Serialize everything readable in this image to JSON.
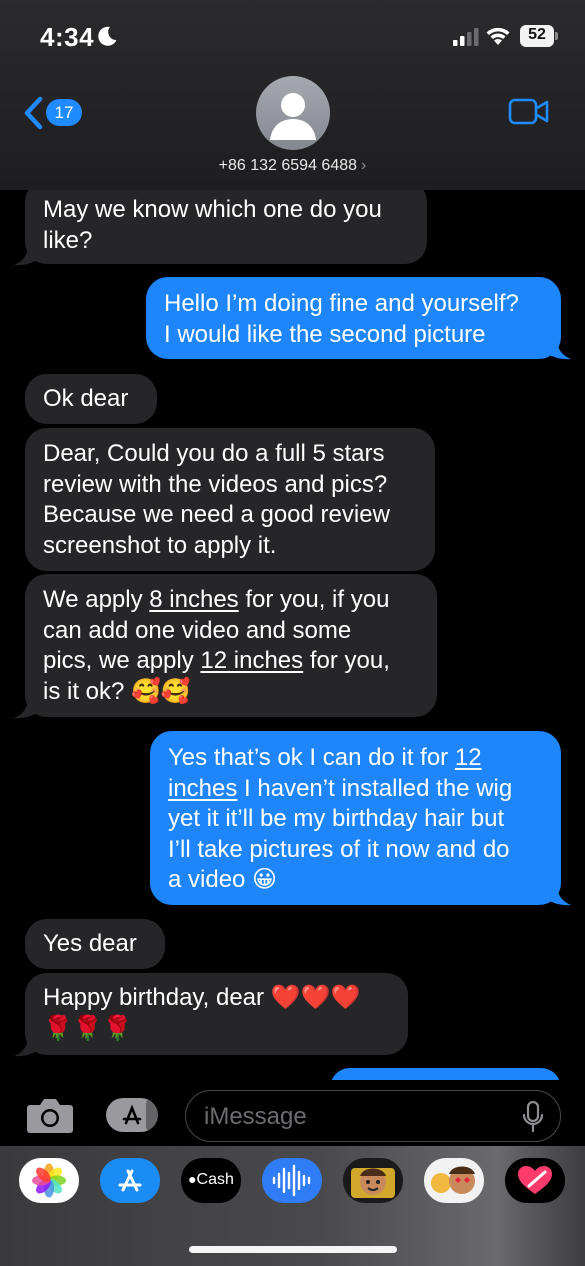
{
  "status_bar": {
    "time": "4:34",
    "battery": "52"
  },
  "header": {
    "back_count": "17",
    "contact": "+86 132 6594 6488",
    "chevron": "›"
  },
  "messages": [
    {
      "dir": "in",
      "lines": [
        "May we know which one do you",
        "like?"
      ]
    },
    {
      "dir": "out",
      "lines": [
        "Hello I’m doing fine and yourself?",
        "I would like the second picture"
      ]
    },
    {
      "dir": "in",
      "lines": [
        "Ok dear"
      ]
    },
    {
      "dir": "in",
      "lines": [
        "Dear, Could you do a full 5 stars",
        "review with the videos and pics?",
        "Because we need a good review",
        "screenshot to apply it."
      ]
    },
    {
      "dir": "in",
      "lines": [
        "We apply 8 inches for you, if you",
        "can add one video and some",
        "pics, we apply 12 inches for you,",
        "is it ok? 🥰🥰"
      ]
    },
    {
      "dir": "out",
      "lines": [
        "Yes that’s ok I can do it for 12",
        "inches I haven’t installed the wig",
        "yet it it’ll be my birthday hair but",
        "I’ll take pictures of it now and do",
        "a video 😀"
      ]
    },
    {
      "dir": "in",
      "lines": [
        "Yes dear"
      ]
    },
    {
      "dir": "in",
      "lines": [
        "Happy birthday, dear ❤️❤️❤️",
        "🌹🌹🌹"
      ]
    }
  ],
  "underlines": [
    "8 inches",
    "12 inches",
    "12",
    "inches"
  ],
  "input": {
    "placeholder": "iMessage"
  },
  "drawer": {
    "cash_label": "Cash"
  },
  "colors": {
    "bubble_in": "#262628",
    "bubble_out": "#1e85fb",
    "accent": "#1f8bff"
  },
  "icons": [
    "moon-icon",
    "signal-icon",
    "wifi-icon",
    "back-chevron-icon",
    "person-icon",
    "video-camera-icon",
    "camera-icon",
    "app-store-icon",
    "mic-icon",
    "photos-icon",
    "apple-cash-icon",
    "audio-wave-icon",
    "memoji-icon",
    "heart-icon"
  ]
}
